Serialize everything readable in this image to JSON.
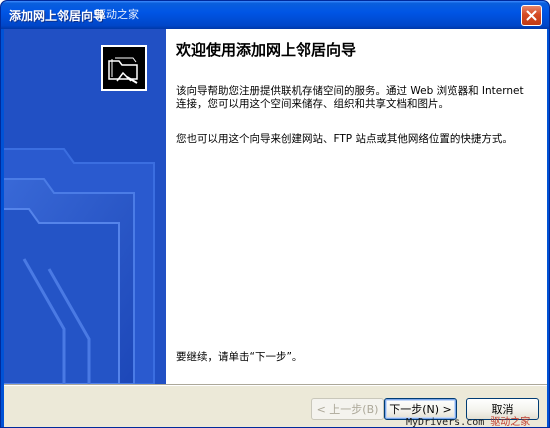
{
  "window": {
    "title": "添加网上邻居向导",
    "watermark_top": "驱动之家"
  },
  "content": {
    "heading": "欢迎使用添加网上邻居向导",
    "paragraph1": "该向导帮助您注册提供联机存储空间的服务。通过 Web 浏览器和 Internet 连接，您可以用这个空间来储存、组织和共享文档和图片。",
    "paragraph2": "您也可以用这个向导来创建网站、FTP 站点或其他网络位置的快捷方式。",
    "prompt": "要继续，请单击“下一步”。"
  },
  "buttons": {
    "back": "< 上一步(B)",
    "next": "下一步(N) >",
    "cancel": "取消"
  },
  "watermark_bottom": {
    "site": "MyDrivers.com",
    "name": "驱动之家"
  },
  "colors": {
    "title_bar": "#0055e5",
    "left_panel": "#2150c4",
    "dialog_bg": "#ece9d8"
  },
  "icons": [
    "close-icon",
    "network-folder-icon"
  ]
}
